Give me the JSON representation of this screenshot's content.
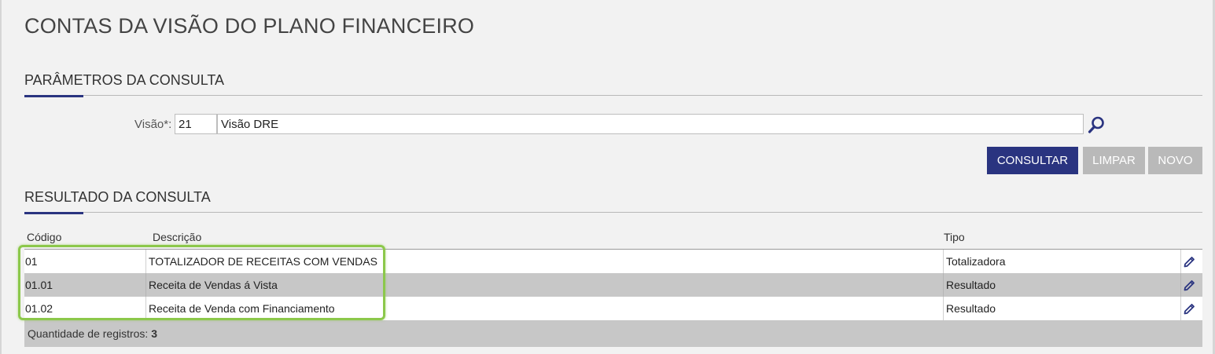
{
  "page": {
    "title": "CONTAS DA VISÃO DO PLANO FINANCEIRO"
  },
  "params": {
    "section_title": "PARÂMETROS DA CONSULTA",
    "visao_label": "Visão*:",
    "visao_code": "21",
    "visao_name": "Visão DRE"
  },
  "buttons": {
    "consultar": "CONSULTAR",
    "limpar": "LIMPAR",
    "novo": "NOVO"
  },
  "results": {
    "section_title": "RESULTADO DA CONSULTA",
    "columns": {
      "codigo": "Código",
      "descricao": "Descrição",
      "tipo": "Tipo"
    },
    "rows": [
      {
        "codigo": "01",
        "descricao": "TOTALIZADOR DE RECEITAS COM VENDAS",
        "tipo": "Totalizadora"
      },
      {
        "codigo": "01.01",
        "descricao": "Receita de Vendas á Vista",
        "tipo": "Resultado"
      },
      {
        "codigo": "01.02",
        "descricao": "Receita de Venda com Financiamento",
        "tipo": "Resultado"
      }
    ],
    "footer_label": "Quantidade de registros:",
    "footer_count": "3"
  },
  "icons": {
    "search": "search-icon",
    "edit": "pencil-icon"
  },
  "colors": {
    "primary": "#2a3480",
    "disabled_button": "#b9b9b9",
    "highlight": "#8cc84b",
    "row_alt": "#c7c7c7"
  }
}
